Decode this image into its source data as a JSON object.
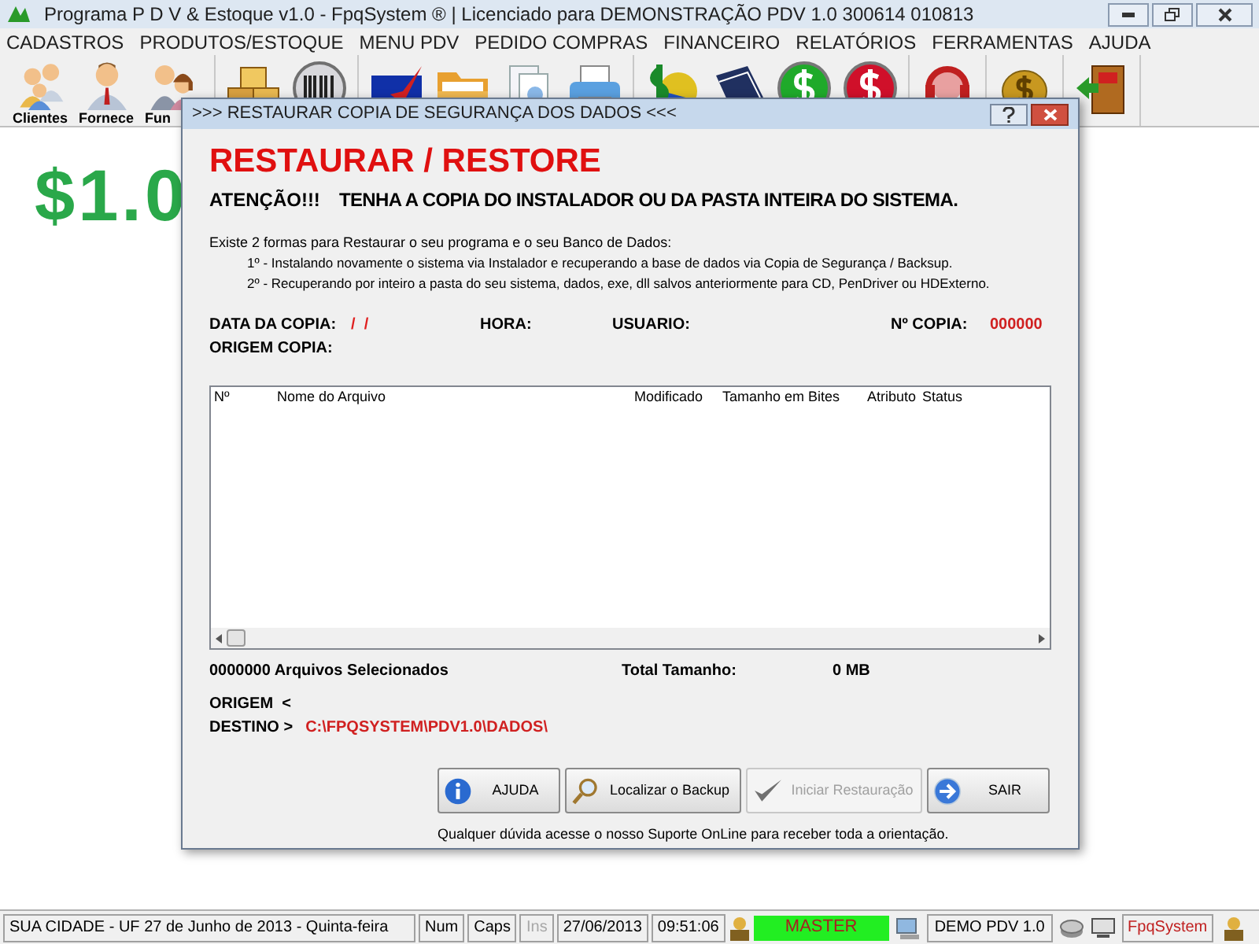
{
  "window": {
    "title": "Programa P D V & Estoque v1.0 - FpqSystem ® | Licenciado para  DEMONSTRAÇÃO PDV 1.0 300614 010813"
  },
  "menu": [
    "CADASTROS",
    "PRODUTOS/ESTOQUE",
    "MENU PDV",
    "PEDIDO COMPRAS",
    "FINANCEIRO",
    "RELATÓRIOS",
    "FERRAMENTAS",
    "AJUDA"
  ],
  "toolbar": {
    "groups": [
      {
        "items": [
          {
            "kind": "people",
            "label": "Clientes"
          },
          {
            "kind": "person",
            "label": "Fornece"
          },
          {
            "kind": "couple",
            "label": "Fun"
          }
        ]
      },
      {
        "items": [
          {
            "kind": "boxes"
          },
          {
            "kind": "barcode"
          }
        ]
      },
      {
        "items": [
          {
            "kind": "flag"
          },
          {
            "kind": "folder"
          },
          {
            "kind": "document"
          },
          {
            "kind": "printer"
          }
        ]
      },
      {
        "items": [
          {
            "kind": "money"
          },
          {
            "kind": "book"
          },
          {
            "kind": "dollar",
            "color": "#1faa2a"
          },
          {
            "kind": "dollar",
            "color": "#d0102a"
          }
        ]
      },
      {
        "items": [
          {
            "kind": "headset"
          }
        ]
      },
      {
        "items": [
          {
            "kind": "coin"
          }
        ]
      },
      {
        "items": [
          {
            "kind": "exit"
          }
        ]
      }
    ]
  },
  "logo": "$1.0",
  "dialog": {
    "title": ">>> RESTAURAR COPIA DE SEGURANÇA DOS DADOS <<<",
    "heading": "RESTAURAR / RESTORE",
    "warning_label": "ATENÇÃO!!!",
    "warning": "TENHA A COPIA DO INSTALADOR OU DA PASTA INTEIRA DO SISTEMA.",
    "intro": "Existe 2 formas para Restaurar o seu programa e o seu Banco de Dados:",
    "options": [
      "1º - Instalando novamente o sistema via Instalador e recuperando a base de dados via Copia de Segurança / Backsup.",
      "2º - Recuperando por inteiro a pasta do seu sistema, dados, exe, dll salvos anteriormente para CD, PenDriver ou HDExterno."
    ],
    "data_copia_label": "DATA DA COPIA:",
    "data_copia": "/  /",
    "hora_label": "HORA:",
    "usuario_label": "USUARIO:",
    "n_copia_label": "Nº COPIA:",
    "n_copia": "000000",
    "origem_copia_label": "ORIGEM COPIA:",
    "table": {
      "columns": [
        "Nº",
        "Nome do Arquivo",
        "Modificado",
        "Tamanho em Bites",
        "Atributo",
        "Status"
      ]
    },
    "selected_count": "0000000 Arquivos Selecionados",
    "total_label": "Total Tamanho:",
    "total": "0 MB",
    "origem_label": "ORIGEM  <",
    "destino_label": "DESTINO >",
    "destino": "C:\\FPQSYSTEM\\PDV1.0\\DADOS\\",
    "buttons": [
      {
        "kind": "info",
        "label": "AJUDA",
        "disabled": false
      },
      {
        "kind": "search",
        "label": "Localizar o Backup",
        "disabled": false
      },
      {
        "kind": "check",
        "label": "Iniciar Restauração",
        "disabled": true
      },
      {
        "kind": "exit",
        "label": "SAIR",
        "disabled": false
      }
    ],
    "footer": "Qualquer dúvida acesse o nosso Suporte OnLine para receber toda a orientação."
  },
  "status_bar": [
    {
      "kind": "text",
      "text": "SUA CIDADE - UF 27 de Junho de 2013 - Quinta-feira",
      "disabled": false
    },
    {
      "kind": "text",
      "text": "Num",
      "disabled": false
    },
    {
      "kind": "text",
      "text": "Caps",
      "disabled": false
    },
    {
      "kind": "text",
      "text": "Ins",
      "disabled": true
    },
    {
      "kind": "text",
      "text": "27/06/2013",
      "disabled": false
    },
    {
      "kind": "text",
      "text": "09:51:06",
      "disabled": false
    },
    {
      "kind": "user",
      "text": "MASTER",
      "disabled": false
    },
    {
      "kind": "pc",
      "text": "DEMO PDV 1.0",
      "disabled": false
    },
    {
      "kind": "icons"
    },
    {
      "kind": "brand",
      "text": "FpqSystem",
      "disabled": false
    },
    {
      "kind": "user-icon"
    }
  ]
}
